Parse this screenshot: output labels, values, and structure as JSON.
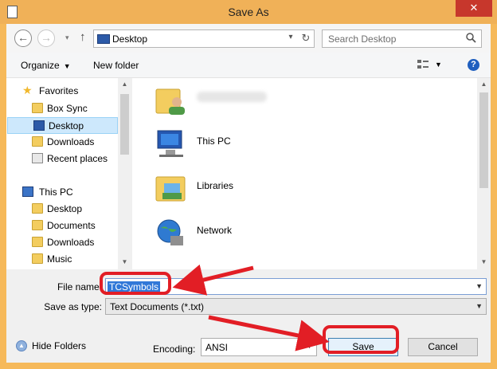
{
  "window": {
    "title": "Save As",
    "close_glyph": "✕"
  },
  "nav": {
    "back_glyph": "←",
    "forward_glyph": "→",
    "recent_glyph": "▾",
    "up_glyph": "↑",
    "address": "Desktop",
    "address_drop_glyph": "▾",
    "refresh_glyph": "↻",
    "search_placeholder": "Search Desktop"
  },
  "toolbar": {
    "organize_label": "Organize",
    "organize_caret": "▼",
    "new_folder_label": "New folder",
    "view_caret": "▼",
    "help_glyph": "?"
  },
  "nav_pane": {
    "favorites": "Favorites",
    "favorites_items": [
      "Box Sync",
      "Desktop",
      "Downloads",
      "Recent places"
    ],
    "this_pc": "This PC",
    "this_pc_items": [
      "Desktop",
      "Documents",
      "Downloads",
      "Music"
    ],
    "selected": "Desktop",
    "scroll_up": "▲",
    "scroll_down": "▼"
  },
  "content": {
    "items": [
      {
        "label": "",
        "icon": "user-folder-icon"
      },
      {
        "label": "This PC",
        "icon": "computer-icon"
      },
      {
        "label": "Libraries",
        "icon": "libraries-icon"
      },
      {
        "label": "Network",
        "icon": "network-icon"
      }
    ],
    "scroll_up": "▲",
    "scroll_down": "▼"
  },
  "form": {
    "file_name_label": "File name:",
    "file_name_value": "TCSymbols",
    "save_as_type_label": "Save as type:",
    "save_as_type_value": "Text Documents (*.txt)",
    "caret": "▼",
    "hide_folders_label": "Hide Folders",
    "hide_folders_glyph": "▲",
    "encoding_label": "Encoding:",
    "encoding_value": "ANSI",
    "save_label": "Save",
    "cancel_label": "Cancel"
  },
  "colors": {
    "title_bar": "#f0b158",
    "close": "#c7372c",
    "selection": "#3178d8",
    "annotation": "#e21e25"
  }
}
